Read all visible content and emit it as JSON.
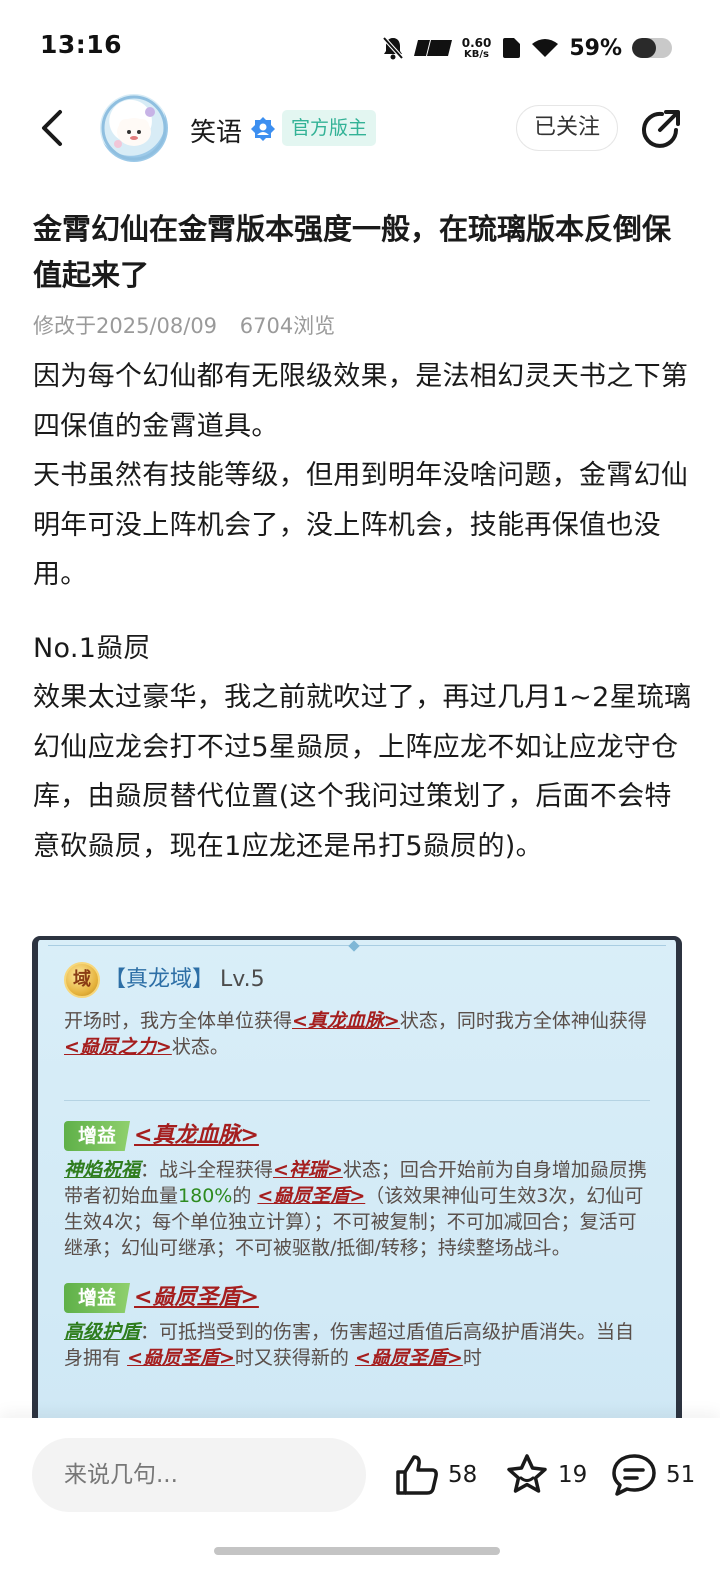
{
  "status_bar": {
    "time": "13:16",
    "net_speed_value": "0.60",
    "net_speed_unit": "KB/s",
    "battery_percent": "59%",
    "battery_level": 0.59,
    "icons": [
      "mute-icon",
      "hd-signal-icon",
      "sim-icon",
      "wifi-icon",
      "battery-icon"
    ]
  },
  "header": {
    "author_name": "笑语",
    "badge": "官方版主",
    "follow_label": "已关注",
    "icons": [
      "back-icon",
      "avatar",
      "verified-icon",
      "share-icon"
    ]
  },
  "post": {
    "title": "金霄幻仙在金霄版本强度一般，在琉璃版本反倒保值起来了",
    "modified": "修改于2025/08/09",
    "views": "6704浏览",
    "paragraphs": [
      "因为每个幻仙都有无限级效果，是法相幻灵天书之下第四保值的金霄道具。",
      "天书虽然有技能等级，但用到明年没啥问题，金霄幻仙明年可没上阵机会了，没上阵机会，技能再保值也没用。",
      "",
      "No.1赑屃",
      "效果太过豪华，我之前就吹过了，再过几月1~2星琉璃幻仙应龙会打不过5星赑屃，上阵应龙不如让应龙守仓库，由赑屃替代位置(这个我问过策划了，后面不会特意砍赑屃，现在1应龙还是吊打5赑屃的)。"
    ]
  },
  "game_image": {
    "domain_icon_char": "域",
    "domain_name": "【真龙域】",
    "domain_level": "Lv.5",
    "intro": {
      "t1": "开场时，我方全体单位获得",
      "k1": "<真龙血脉>",
      "t2": "状态，同时我方全体神仙获得",
      "k2": "<赑屃之力>",
      "t3": "状态。"
    },
    "buff1": {
      "tag": "增益",
      "name": "<真龙血脉>",
      "skill": "神焰祝福",
      "t1": "：战斗全程获得",
      "k1": "<祥瑞>",
      "t2": "状态；回合开始前为自身增加赑屃携带者初始血量",
      "pct": "180%",
      "t3": "的",
      "k2": "<赑屃圣盾>",
      "t4": "（该效果神仙可生效3次，幻仙可生效4次；每个单位独立计算）；不可被复制；不可加减回合；复活可继承；幻仙可继承；不可被驱散/抵御/转移；持续整场战斗。"
    },
    "buff2": {
      "tag": "增益",
      "name": "<赑屃圣盾>",
      "skill": "高级护盾",
      "t1": "：可抵挡受到的伤害，伤害超过盾值后高级护盾消失。当自身拥有",
      "k1": "<赑屃圣盾>",
      "t2": "时又获得新的",
      "k2": "<赑屃圣盾>",
      "t3": "时"
    }
  },
  "bottom_bar": {
    "comment_placeholder": "来说几句...",
    "likes": "58",
    "favorites": "19",
    "comments": "51"
  }
}
